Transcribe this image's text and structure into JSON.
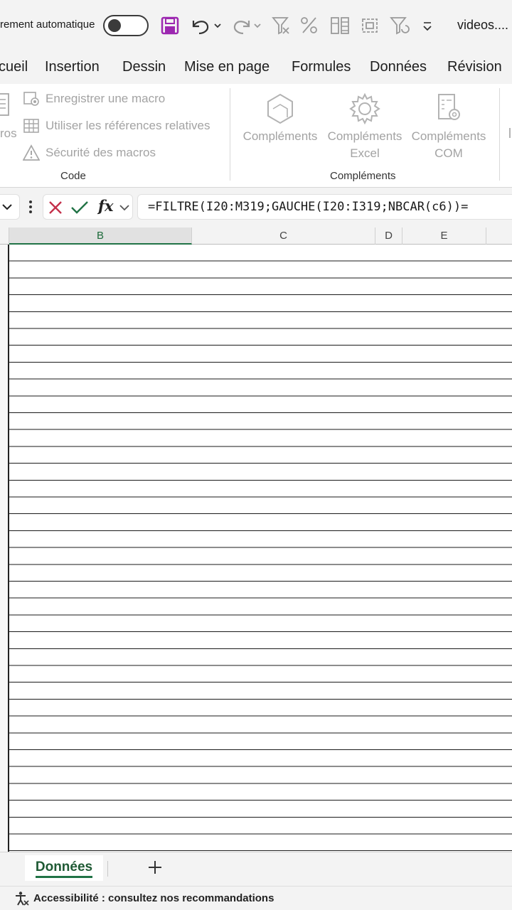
{
  "titlebar": {
    "autosave_label": "rement automatique",
    "file_title": "videos...."
  },
  "quick_access_icons": [
    "save-icon",
    "undo-icon",
    "redo-icon",
    "clear-filter-icon",
    "percent-icon",
    "data-compare-icon",
    "select-range-icon",
    "filter-refresh-icon",
    "customize-icon"
  ],
  "tabs": [
    "cueil",
    "Insertion",
    "Dessin",
    "Mise en page",
    "Formules",
    "Données",
    "Révision"
  ],
  "ribbon": {
    "code_group": {
      "label": "Code",
      "partial_button": "ros",
      "record_macro": "Enregistrer une macro",
      "relative_refs": "Utiliser les références relatives",
      "macro_security": "Sécurité des macros"
    },
    "addins_group": {
      "label": "Compléments",
      "addins": "Compléments",
      "excel_addins_1": "Compléments",
      "excel_addins_2": "Excel",
      "com_addins_1": "Compléments",
      "com_addins_2": "COM"
    }
  },
  "formula_bar": {
    "fx_label": "fx",
    "formula": "=FILTRE(I20:M319;GAUCHE(I20:I319;NBCAR(c6))="
  },
  "columns": [
    "B",
    "C",
    "D",
    "E"
  ],
  "active_column": "B",
  "sheets": {
    "active": "Données",
    "add_label": "+"
  },
  "status": {
    "accessibility": "Accessibilité : consultez nos recommandations"
  },
  "colors": {
    "accent_green": "#217346",
    "save_purple": "#9c27b0",
    "cancel_red": "#c4314b"
  }
}
